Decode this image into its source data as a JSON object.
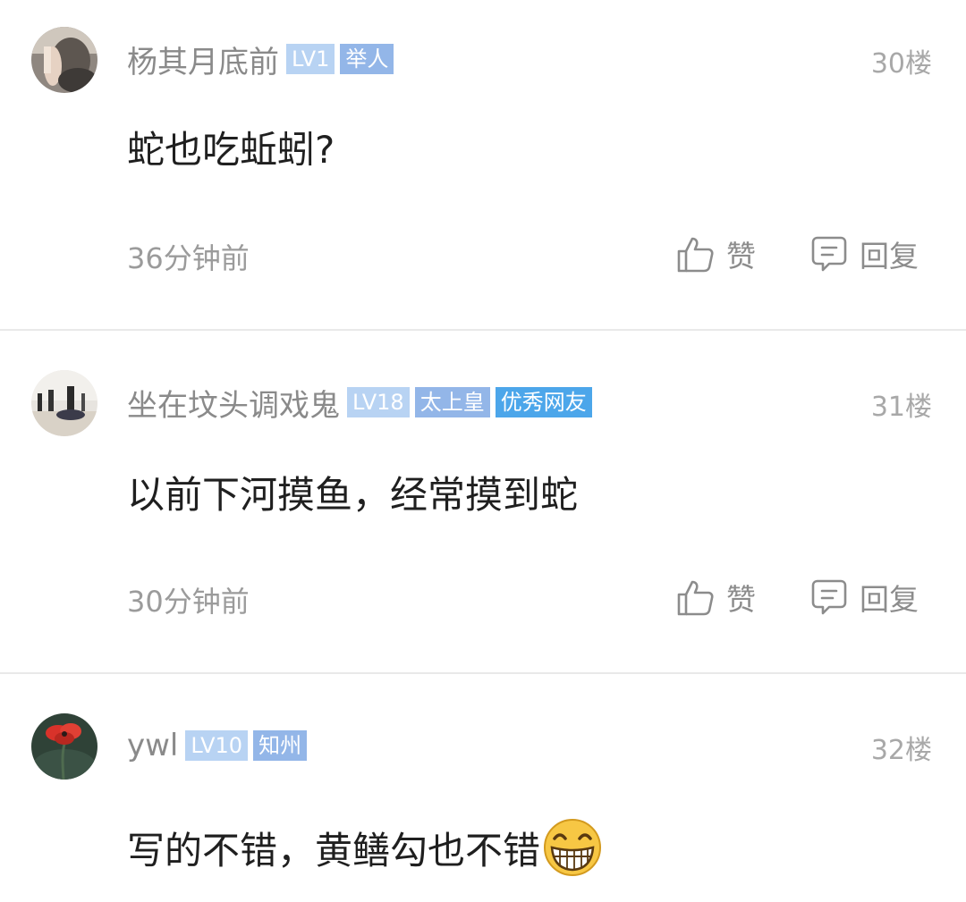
{
  "comments": [
    {
      "username": "杨其月底前",
      "badges": [
        "LV1",
        "举人"
      ],
      "floor": "30楼",
      "content": "蛇也吃蚯蚓?",
      "time": "36分钟前",
      "like_label": "赞",
      "reply_label": "回复"
    },
    {
      "username": "坐在坟头调戏鬼",
      "badges": [
        "LV18",
        "太上皇",
        "优秀网友"
      ],
      "floor": "31楼",
      "content": "以前下河摸鱼，经常摸到蛇",
      "time": "30分钟前",
      "like_label": "赞",
      "reply_label": "回复"
    },
    {
      "username": "ywl",
      "badges": [
        "LV10",
        "知州"
      ],
      "floor": "32楼",
      "content": "写的不错，黄鳝勾也不错",
      "emoji": "grinning-face-icon"
    }
  ],
  "colors": {
    "username": "#8a8a8a",
    "level_badge": "#b8d3f3",
    "title_badge": "#93b6e8",
    "honor_badge": "#4ca6ea",
    "floor": "#a8a8a8",
    "meta": "#9b9b9b",
    "divider": "#e9e9e9"
  },
  "icons": {
    "like": "thumbs-up-icon",
    "reply": "comment-bubble-icon"
  }
}
